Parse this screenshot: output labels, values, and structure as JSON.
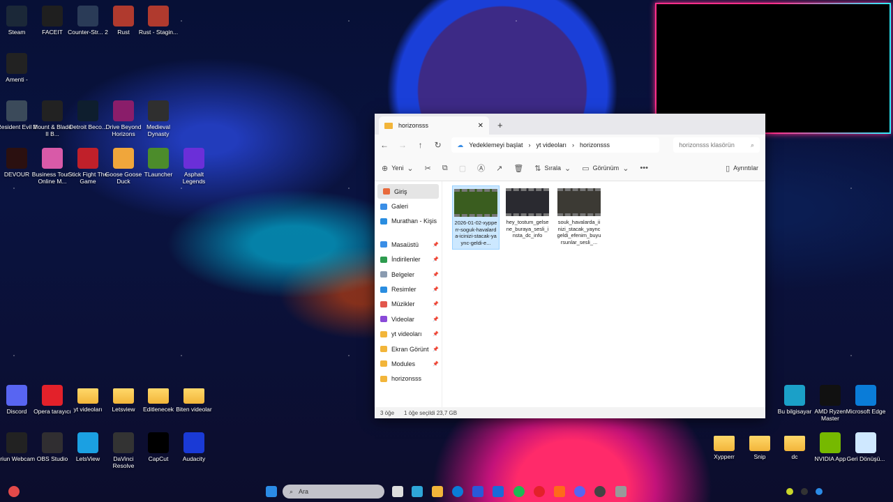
{
  "desktop_icons": [
    {
      "label": "Steam",
      "color": "#1b2838"
    },
    {
      "label": "FACEIT",
      "color": "#1f1f1f"
    },
    {
      "label": "Counter-Str... 2",
      "color": "#2a3b57"
    },
    {
      "label": "Rust",
      "color": "#b03a2e"
    },
    {
      "label": "Rust - Stagin...",
      "color": "#b03a2e"
    },
    {
      "label": "Amenti -",
      "color": "#222"
    },
    {
      "label": "Resident Evil 2",
      "color": "#3b4a5a"
    },
    {
      "label": "Mount & Blade II B...",
      "color": "#222"
    },
    {
      "label": "Detroit Beco...",
      "color": "#0e1e2e"
    },
    {
      "label": "Drive Beyond Horizons",
      "color": "#8a1d6a"
    },
    {
      "label": "Medieval Dynasty",
      "color": "#2f2f2f"
    },
    {
      "label": "DEVOUR",
      "color": "#2b1010"
    },
    {
      "label": "Business Tour - Online M...",
      "color": "#d85aa8"
    },
    {
      "label": "Stick Fight The Game",
      "color": "#c0202a"
    },
    {
      "label": "Goose Goose Duck",
      "color": "#f0a63b"
    },
    {
      "label": "TLauncher",
      "color": "#4c8c2b"
    },
    {
      "label": "Asphalt Legends",
      "color": "#6b2fd8"
    },
    {
      "label": "Discord",
      "color": "#5865f2"
    },
    {
      "label": "Opera tarayıcı",
      "color": "#e3212a"
    },
    {
      "label": "yt videoları",
      "color": "folder"
    },
    {
      "label": "Letsview",
      "color": "folder"
    },
    {
      "label": "Editlenecek",
      "color": "folder"
    },
    {
      "label": "Biten videolar",
      "color": "folder"
    },
    {
      "label": "Iriun Webcam",
      "color": "#222"
    },
    {
      "label": "OBS Studio",
      "color": "#302e31"
    },
    {
      "label": "LetsView",
      "color": "#1ba0e2"
    },
    {
      "label": "DaVinci Resolve",
      "color": "#333"
    },
    {
      "label": "CapCut",
      "color": "#000"
    },
    {
      "label": "Audacity",
      "color": "#1a3ad6"
    },
    {
      "label": "Bu bilgisayar",
      "color": "#1ba0c8"
    },
    {
      "label": "AMD Ryzen Master",
      "color": "#111"
    },
    {
      "label": "Microsoft Edge",
      "color": "#0a7cd8"
    },
    {
      "label": "Xypperr",
      "color": "folder"
    },
    {
      "label": "Snip",
      "color": "folder"
    },
    {
      "label": "dc",
      "color": "folder"
    },
    {
      "label": "NVIDIA App",
      "color": "#76b900"
    },
    {
      "label": "Geri Dönüşü...",
      "color": "#cfe8ff"
    }
  ],
  "explorer": {
    "tab_title": "horizonsss",
    "breadcrumb": [
      "Yedeklemeyi başlat",
      "yt videoları",
      "horizonsss"
    ],
    "search_placeholder": "horizonsss klasörün",
    "toolbar": {
      "new": "Yeni",
      "sort": "Sırala",
      "view": "Görünüm",
      "details": "Ayrıntılar"
    },
    "nav": [
      {
        "label": "Giriş",
        "color": "#e86a3c",
        "pinned": false
      },
      {
        "label": "Galeri",
        "color": "#3a8ee6",
        "pinned": false
      },
      {
        "label": "Murathan - Kişis",
        "color": "#2a8de0",
        "pinned": false
      },
      {
        "label": "Masaüstü",
        "color": "#3a8ee6",
        "pinned": true
      },
      {
        "label": "İndirilenler",
        "color": "#2e9b4f",
        "pinned": true
      },
      {
        "label": "Belgeler",
        "color": "#8a9bb0",
        "pinned": true
      },
      {
        "label": "Resimler",
        "color": "#2a8de0",
        "pinned": true
      },
      {
        "label": "Müzikler",
        "color": "#e2574c",
        "pinned": true
      },
      {
        "label": "Videolar",
        "color": "#8a4ad8",
        "pinned": true
      },
      {
        "label": "yt videoları",
        "color": "#f2b53a",
        "pinned": true
      },
      {
        "label": "Ekran Görünt",
        "color": "#f2b53a",
        "pinned": true
      },
      {
        "label": "Modules",
        "color": "#f2b53a",
        "pinned": true
      },
      {
        "label": "horizonsss",
        "color": "#f2b53a",
        "pinned": false
      }
    ],
    "files": [
      {
        "name": "2026-01-02-xypperr-soguk-havalarda-icinizi-stacak-yaync-geldi-e...",
        "selected": true
      },
      {
        "name": "hey_tostum_gelsene_buraya_sesli_insta_dc_info",
        "selected": false
      },
      {
        "name": "souk_havalarda_iinizi_stacak_yayncgeldi_efenim_buyursunlar_sesli_...",
        "selected": false
      }
    ],
    "status": {
      "count": "3 öğe",
      "selected": "1 öğe seçildi  23,7 GB"
    }
  },
  "taskbar": {
    "search_placeholder": "Ara"
  }
}
